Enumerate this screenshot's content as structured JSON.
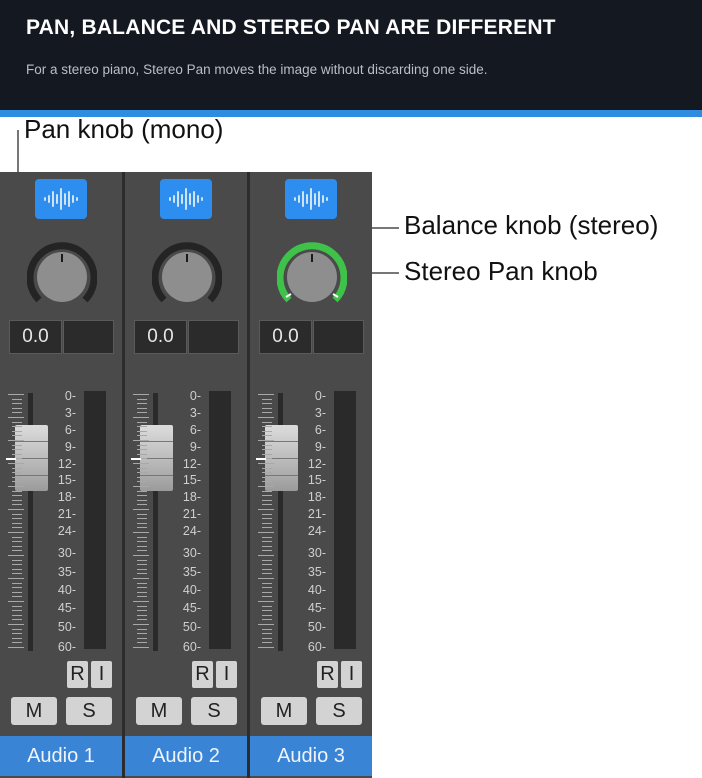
{
  "banner": {
    "title": "PAN, BALANCE AND STEREO PAN ARE DIFFERENT",
    "subtitle": "For a stereo piano, Stereo Pan moves the image without discarding one side."
  },
  "callouts": {
    "pan": "Pan knob (mono)",
    "balance": "Balance knob (stereo)",
    "stereo_pan": "Stereo Pan knob"
  },
  "colors": {
    "accent": "#2f8ce0",
    "stereo_pan_ring": "#3fc24a",
    "track_name_bg": "#3a84d6"
  },
  "fader_scale": [
    "0",
    "3",
    "6",
    "9",
    "12",
    "15",
    "18",
    "21",
    "24",
    "30",
    "35",
    "40",
    "45",
    "50",
    "60"
  ],
  "strips": [
    {
      "name": "Audio 1",
      "value": "0.0",
      "knob_type": "pan",
      "record": "R",
      "input": "I",
      "mute": "M",
      "solo": "S"
    },
    {
      "name": "Audio 2",
      "value": "0.0",
      "knob_type": "balance",
      "record": "R",
      "input": "I",
      "mute": "M",
      "solo": "S"
    },
    {
      "name": "Audio 3",
      "value": "0.0",
      "knob_type": "stereo-pan",
      "record": "R",
      "input": "I",
      "mute": "M",
      "solo": "S"
    }
  ]
}
